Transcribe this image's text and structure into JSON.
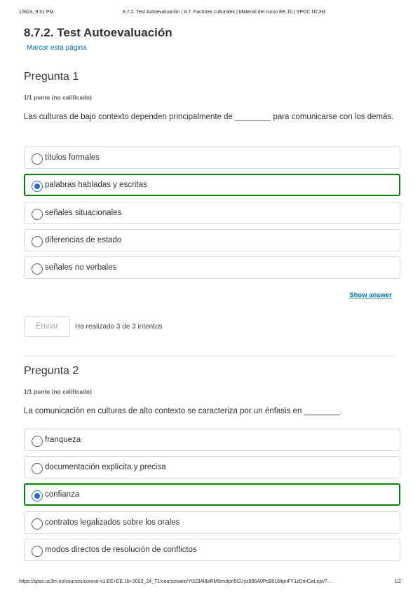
{
  "print_header": {
    "date": "1/9/24, 9:51 PM",
    "title": "8.7.2. Test Autoevaluación | 8.7. Factores culturales | Material del curso EE.1b | SPOC UC3M"
  },
  "unit_title": "8.7.2. Test Autoevaluación",
  "bookmark_label": "Marcar esta página",
  "questions": [
    {
      "title": "Pregunta 1",
      "points": "1/1 punto (no calificado)",
      "prompt": "Las culturas de bajo contexto dependen principalmente de ________ para comunicarse con los demás.",
      "options": [
        "títulos formales",
        "palabras habladas y escritas",
        "señales situacionales",
        "diferencias de estado",
        "señales no verbales"
      ],
      "selected_index": 1,
      "show_answer_label": "Show answer",
      "submit_label": "Enviar",
      "attempts_text": "Ha realizado 3 de 3 intentos"
    },
    {
      "title": "Pregunta 2",
      "points": "1/1 punto (no calificado)",
      "prompt": "La comunicación en culturas de alto contexto se caracteriza por un énfasis en ________.",
      "options": [
        "franqueza",
        "documentación explícita y precisa",
        "confianza",
        "contratos legalizados sobre los orales",
        "modos directos de resolución de conflictos"
      ],
      "selected_index": 2
    }
  ],
  "print_footer": {
    "url": "https://spoc.uc3m.es/courses/course-v1:EE+EE.1b+2023_24_T1/courseware/Yt1DlAl8oRM0mufpn5CUyz986A0Po9816ltpnFY1zDmCwLeje/?…",
    "page": "1/2"
  },
  "colors": {
    "correct_border": "#008100",
    "radio_selected": "#2b66d4",
    "link": "#0075b4"
  }
}
